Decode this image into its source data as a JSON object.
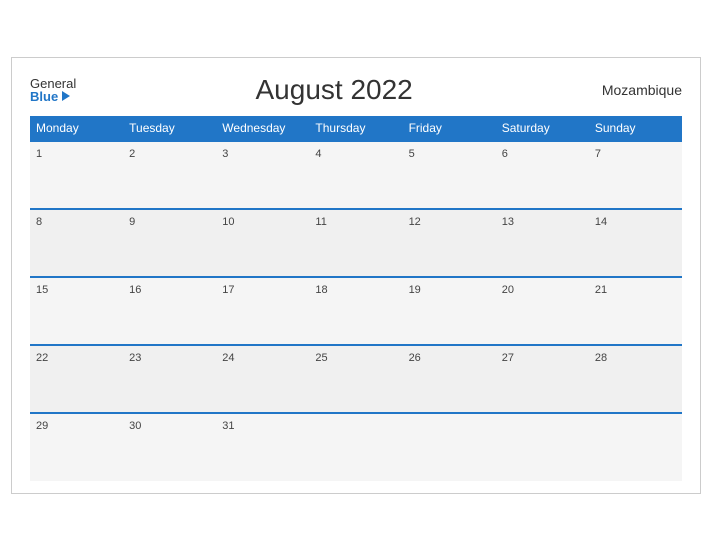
{
  "header": {
    "logo_general": "General",
    "logo_blue": "Blue",
    "title": "August 2022",
    "country": "Mozambique"
  },
  "weekdays": [
    "Monday",
    "Tuesday",
    "Wednesday",
    "Thursday",
    "Friday",
    "Saturday",
    "Sunday"
  ],
  "weeks": [
    [
      {
        "day": "1"
      },
      {
        "day": "2"
      },
      {
        "day": "3"
      },
      {
        "day": "4"
      },
      {
        "day": "5"
      },
      {
        "day": "6"
      },
      {
        "day": "7"
      }
    ],
    [
      {
        "day": "8"
      },
      {
        "day": "9"
      },
      {
        "day": "10"
      },
      {
        "day": "11"
      },
      {
        "day": "12"
      },
      {
        "day": "13"
      },
      {
        "day": "14"
      }
    ],
    [
      {
        "day": "15"
      },
      {
        "day": "16"
      },
      {
        "day": "17"
      },
      {
        "day": "18"
      },
      {
        "day": "19"
      },
      {
        "day": "20"
      },
      {
        "day": "21"
      }
    ],
    [
      {
        "day": "22"
      },
      {
        "day": "23"
      },
      {
        "day": "24"
      },
      {
        "day": "25"
      },
      {
        "day": "26"
      },
      {
        "day": "27"
      },
      {
        "day": "28"
      }
    ],
    [
      {
        "day": "29"
      },
      {
        "day": "30"
      },
      {
        "day": "31"
      },
      {
        "day": ""
      },
      {
        "day": ""
      },
      {
        "day": ""
      },
      {
        "day": ""
      }
    ]
  ],
  "colors": {
    "header_bg": "#2176c7",
    "accent": "#2176c7"
  }
}
